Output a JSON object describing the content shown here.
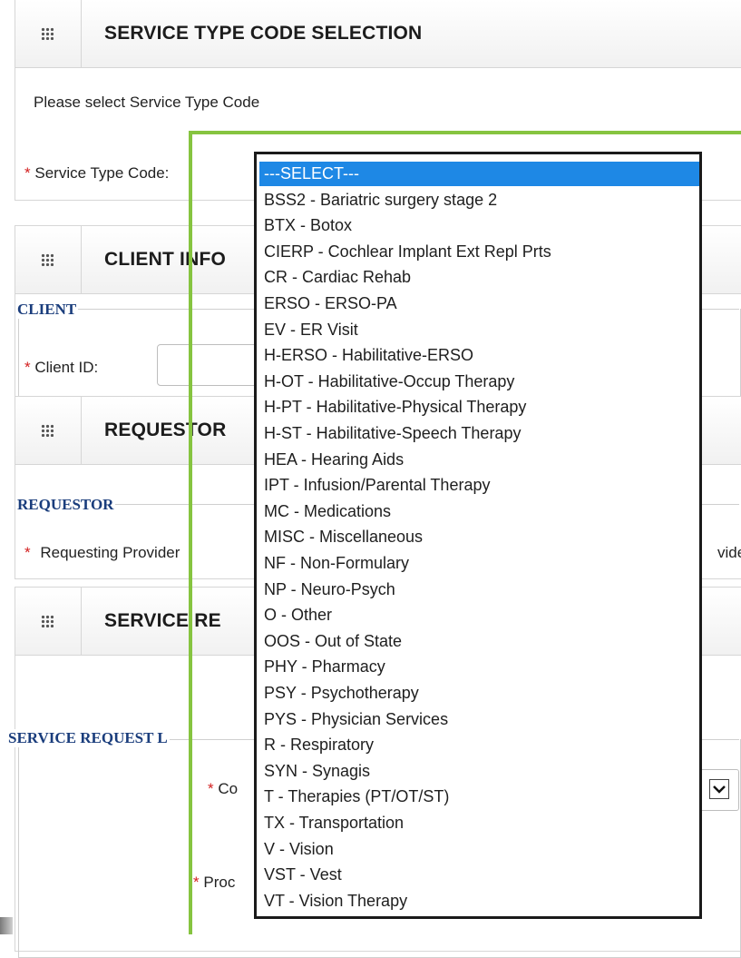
{
  "panels": {
    "service_type": {
      "title": "SERVICE TYPE CODE SELECTION",
      "instructions": "Please select Service Type Code",
      "field_label": "Service Type Code:",
      "required_mark": "*"
    },
    "client": {
      "title_visible": "CLIENT INFO",
      "section_label": "CLIENT",
      "field_label": "Client ID:",
      "required_mark": "*"
    },
    "requestor": {
      "title_visible": "REQUESTOR",
      "section_label": "REQUESTOR",
      "field_label_visible": "Requesting Provider",
      "field_label_right_fragment": "vide",
      "required_mark": "*"
    },
    "service_request": {
      "title_visible": "SERVICE RE",
      "section_label_visible": "SERVICE REQUEST L",
      "field1_fragment": "Co",
      "field2_fragment": "Proc",
      "required_mark": "*"
    }
  },
  "dropdown": {
    "selected_index": 0,
    "options": [
      "---SELECT---",
      "BSS2 - Bariatric surgery stage 2",
      "BTX - Botox",
      "CIERP - Cochlear Implant Ext Repl Prts",
      "CR - Cardiac Rehab",
      "ERSO - ERSO-PA",
      "EV - ER Visit",
      "H-ERSO - Habilitative-ERSO",
      "H-OT - Habilitative-Occup Therapy",
      "H-PT - Habilitative-Physical Therapy",
      "H-ST - Habilitative-Speech Therapy",
      "HEA - Hearing Aids",
      "IPT - Infusion/Parental Therapy",
      "MC - Medications",
      "MISC - Miscellaneous",
      "NF - Non-Formulary",
      "NP - Neuro-Psych",
      "O - Other",
      "OOS - Out of State",
      "PHY - Pharmacy",
      "PSY - Psychotherapy",
      "PYS - Physician Services",
      "R - Respiratory",
      "SYN - Synagis",
      "T - Therapies (PT/OT/ST)",
      "TX - Transportation",
      "V - Vision",
      "VST - Vest",
      "VT - Vision Therapy"
    ]
  },
  "colors": {
    "highlight_box": "#86c440",
    "selected_option": "#1e88e5",
    "section_label": "#1a3d7c",
    "required": "#d32020"
  },
  "icons": {
    "panel_header": "grid-icon",
    "select_arrow": "chevron-down-icon"
  }
}
